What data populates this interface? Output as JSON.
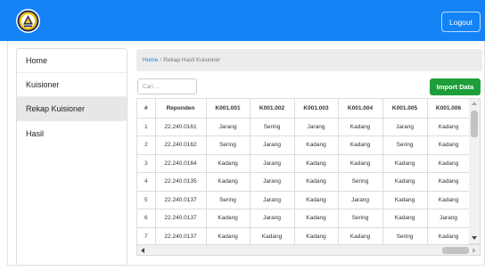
{
  "colors": {
    "header": "#1383f6",
    "import_button": "#1e9e3a",
    "link": "#1a7fe0",
    "active_nav": "#e7e7e7"
  },
  "header": {
    "logo_icon": "institution-logo",
    "logout_label": "Logout"
  },
  "sidebar": {
    "items": [
      {
        "label": "Home",
        "active": false
      },
      {
        "label": "Kuisioner",
        "active": false
      },
      {
        "label": "Rekap Kuisioner",
        "active": true
      },
      {
        "label": "Hasil",
        "active": false
      }
    ]
  },
  "breadcrumb": {
    "home": "Home",
    "separator": "/",
    "current": "Rekap Hasil Kuisioner"
  },
  "search": {
    "placeholder": "Cari ...",
    "value": ""
  },
  "import_button": {
    "label": "Import Data"
  },
  "table": {
    "columns": [
      "#",
      "Reponden",
      "K001.001",
      "K001.002",
      "K001.003",
      "K001.004",
      "K001.005",
      "K001.006"
    ],
    "rows": [
      [
        "1",
        "22.240.0161",
        "Jarang",
        "Sering",
        "Jarang",
        "Kadang",
        "Jarang",
        "Kadang"
      ],
      [
        "2",
        "22.240.0162",
        "Sering",
        "Jarang",
        "Kadang",
        "Kadang",
        "Sering",
        "Kadang"
      ],
      [
        "3",
        "22.240.0164",
        "Kadang",
        "Jarang",
        "Kadang",
        "Kadang",
        "Kadang",
        "Kadang"
      ],
      [
        "4",
        "22.240.0135",
        "Kadang",
        "Jarang",
        "Kadang",
        "Sering",
        "Kadang",
        "Kadang"
      ],
      [
        "5",
        "22.240.0137",
        "Sering",
        "Jarang",
        "Kadang",
        "Jarang",
        "Kadang",
        "Kadang"
      ],
      [
        "6",
        "22.240.0137",
        "Kadang",
        "Jarang",
        "Kadang",
        "Sering",
        "Kadang",
        "Jarang"
      ],
      [
        "7",
        "22.240.0137",
        "Kadang",
        "Kadang",
        "Kadang",
        "Kadang",
        "Sering",
        "Kadang"
      ]
    ]
  }
}
